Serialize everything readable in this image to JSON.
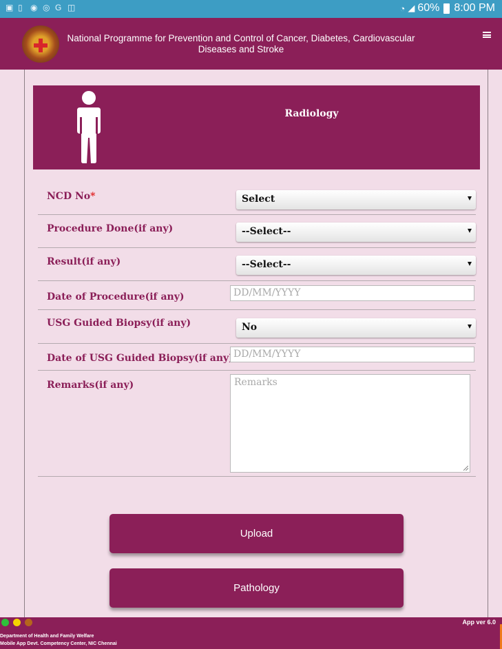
{
  "status_bar": {
    "battery": "60%",
    "time": "8:00 PM",
    "notification_icons": [
      "gallery-icon",
      "sim-icon",
      "chrome-icon",
      "sync-icon",
      "gmail-icon",
      "photo-icon"
    ]
  },
  "app_bar": {
    "title_line1": "National Programme for Prevention and Control of Cancer, Diabetes, Cardiovascular",
    "title_line2": "Diseases and Stroke",
    "menu_icon": "hamburger-menu-icon"
  },
  "section": {
    "title": "Radiology",
    "icon": "person-icon"
  },
  "form": {
    "ncd_no": {
      "label": "NCD No",
      "required_mark": "*",
      "value": "Select"
    },
    "procedure_done": {
      "label": "Procedure Done(if any)",
      "value": "--Select--"
    },
    "result": {
      "label": "Result(if any)",
      "value": "--Select--"
    },
    "date_of_procedure": {
      "label": "Date of Procedure(if any)",
      "placeholder": "DD/MM/YYYY"
    },
    "usg_guided_biopsy": {
      "label": "USG Guided Biopsy(if any)",
      "value": "No"
    },
    "date_of_usg_biopsy": {
      "label": "Date of USG Guided Biopsy(if any)",
      "placeholder": "DD/MM/YYYY"
    },
    "remarks": {
      "label": "Remarks(if any)",
      "placeholder": "Remarks"
    }
  },
  "buttons": {
    "upload": "Upload",
    "pathology": "Pathology"
  },
  "footer": {
    "line1": "Department of Health and Family Welfare",
    "line2": "Mobile App Devt. Competency Center, NIC Chennai",
    "version": "App ver 6.0",
    "dot_colors": [
      "#2fbf3a",
      "#f5d300",
      "#b5651d"
    ]
  },
  "colors": {
    "brand": "#8b1f58",
    "background": "#f2dde8",
    "status_bar": "#3d9dc4",
    "required": "#e02020"
  }
}
